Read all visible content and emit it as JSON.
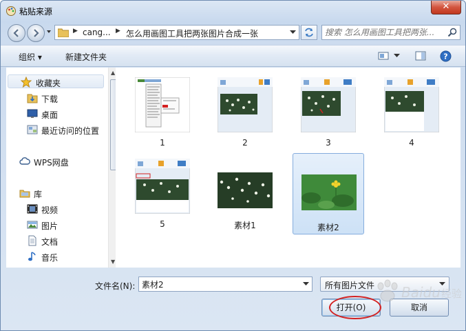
{
  "window": {
    "title": "粘贴来源",
    "close_label": "✕"
  },
  "address": {
    "crumbs": [
      "cang...",
      "怎么用画图工具把两张图片合成一张"
    ]
  },
  "search": {
    "placeholder": "搜索 怎么用画图工具把两张..."
  },
  "toolbar": {
    "organize": "组织 ▾",
    "new_folder": "新建文件夹"
  },
  "nav": {
    "favorites": "收藏夹",
    "downloads": "下载",
    "desktop": "桌面",
    "recent": "最近访问的位置",
    "wps": "WPS网盘",
    "library": "库",
    "videos": "视频",
    "pictures": "图片",
    "documents": "文档",
    "music": "音乐"
  },
  "files": [
    {
      "name": "1",
      "selected": false
    },
    {
      "name": "2",
      "selected": false
    },
    {
      "name": "3",
      "selected": false
    },
    {
      "name": "4",
      "selected": false
    },
    {
      "name": "5",
      "selected": false
    },
    {
      "name": "素材1",
      "selected": false
    },
    {
      "name": "素材2",
      "selected": true
    }
  ],
  "footer": {
    "filename_label": "文件名(N):",
    "filename_value": "素材2",
    "filter": "所有图片文件",
    "open_label": "打开(O)",
    "cancel_label": "取消"
  },
  "watermark": "Baidu 经验",
  "colors": {
    "accent": "#3f7dc5",
    "annotation": "#d32020",
    "selection": "#cde1f6"
  }
}
